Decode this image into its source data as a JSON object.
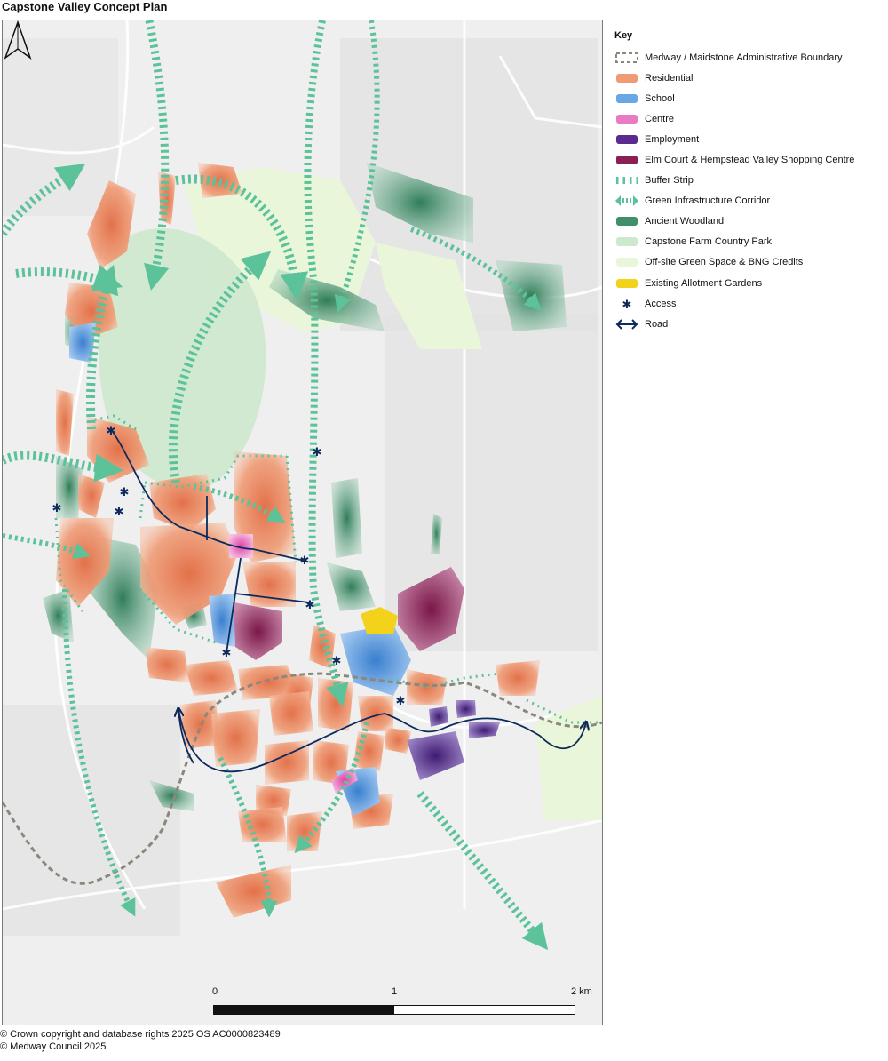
{
  "title": "Capstone Valley Concept Plan",
  "legend": {
    "title": "Key",
    "items": [
      {
        "label": "Medway / Maidstone Administrative Boundary",
        "icon": "boundary-dashed-icon",
        "color": "#8c877c"
      },
      {
        "label": "Residential",
        "icon": "residential-swatch-icon",
        "color": "#e8845a"
      },
      {
        "label": "School",
        "icon": "school-swatch-icon",
        "color": "#4b8fd6"
      },
      {
        "label": "Centre",
        "icon": "centre-swatch-icon",
        "color": "#e35fb5"
      },
      {
        "label": "Employment",
        "icon": "employment-swatch-icon",
        "color": "#5a2a8f"
      },
      {
        "label": "Elm Court & Hempstead Valley Shopping Centre",
        "icon": "shopping-centre-swatch-icon",
        "color": "#8a1f55"
      },
      {
        "label": "Buffer Strip",
        "icon": "buffer-strip-icon",
        "color": "#5cc29a"
      },
      {
        "label": "Green Infrastructure Corridor",
        "icon": "gi-corridor-arrow-icon",
        "color": "#5cc29a"
      },
      {
        "label": "Ancient Woodland",
        "icon": "ancient-woodland-swatch-icon",
        "color": "#3f8f6a"
      },
      {
        "label": "Capstone Farm Country Park",
        "icon": "country-park-swatch-icon",
        "color": "#cde8cd"
      },
      {
        "label": "Off-site Green Space & BNG Credits",
        "icon": "offsite-green-swatch-icon",
        "color": "#eaf6d9"
      },
      {
        "label": "Existing Allotment Gardens",
        "icon": "allotment-swatch-icon",
        "color": "#f2d21b"
      },
      {
        "label": "Access",
        "icon": "access-asterisk-icon",
        "color": "#0d2a5c"
      },
      {
        "label": "Road",
        "icon": "road-double-arrow-icon",
        "color": "#0d2a5c"
      }
    ]
  },
  "scale": {
    "labels": [
      "0",
      "1",
      "2 km"
    ]
  },
  "credits": [
    "© Crown copyright and database rights 2025 OS AC0000823489",
    "© Medway Council 2025"
  ]
}
